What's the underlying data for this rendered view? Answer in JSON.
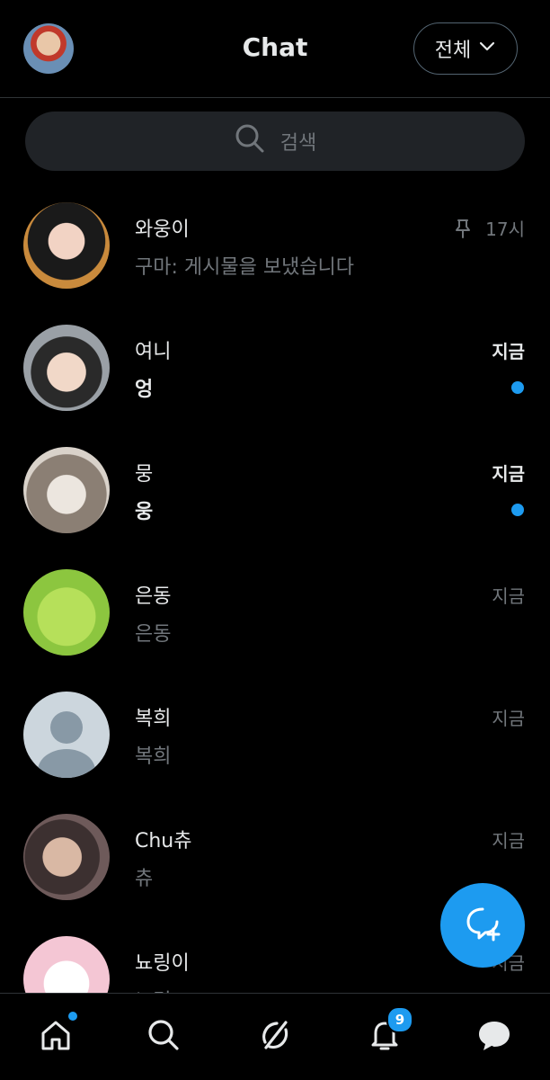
{
  "header": {
    "title": "Chat",
    "filter_label": "전체"
  },
  "search": {
    "placeholder": "검색"
  },
  "chats": [
    {
      "name": "와웅이",
      "preview": "구마: 게시물을 보냈습니다",
      "time": "17시",
      "pinned": true,
      "unread": false
    },
    {
      "name": "여니",
      "preview": "엉",
      "time": "지금",
      "pinned": false,
      "unread": true
    },
    {
      "name": "뭉",
      "preview": "웅",
      "time": "지금",
      "pinned": false,
      "unread": true
    },
    {
      "name": "은동",
      "preview": "은동",
      "time": "지금",
      "pinned": false,
      "unread": false
    },
    {
      "name": "복희",
      "preview": "복희",
      "time": "지금",
      "pinned": false,
      "unread": false
    },
    {
      "name": "Chu츄",
      "preview": "츄",
      "time": "지금",
      "pinned": false,
      "unread": false
    },
    {
      "name": "뇨링이",
      "preview": "뇨링",
      "time": "지금",
      "pinned": false,
      "unread": false
    }
  ],
  "bottom_nav": {
    "notifications_count": "9",
    "items": [
      "home-icon",
      "search-icon",
      "grok-icon",
      "bell-icon",
      "messages-icon"
    ]
  },
  "colors": {
    "accent": "#1d9bf0",
    "background": "#000000",
    "text_primary": "#e7e9ea",
    "text_secondary": "#71767b"
  }
}
